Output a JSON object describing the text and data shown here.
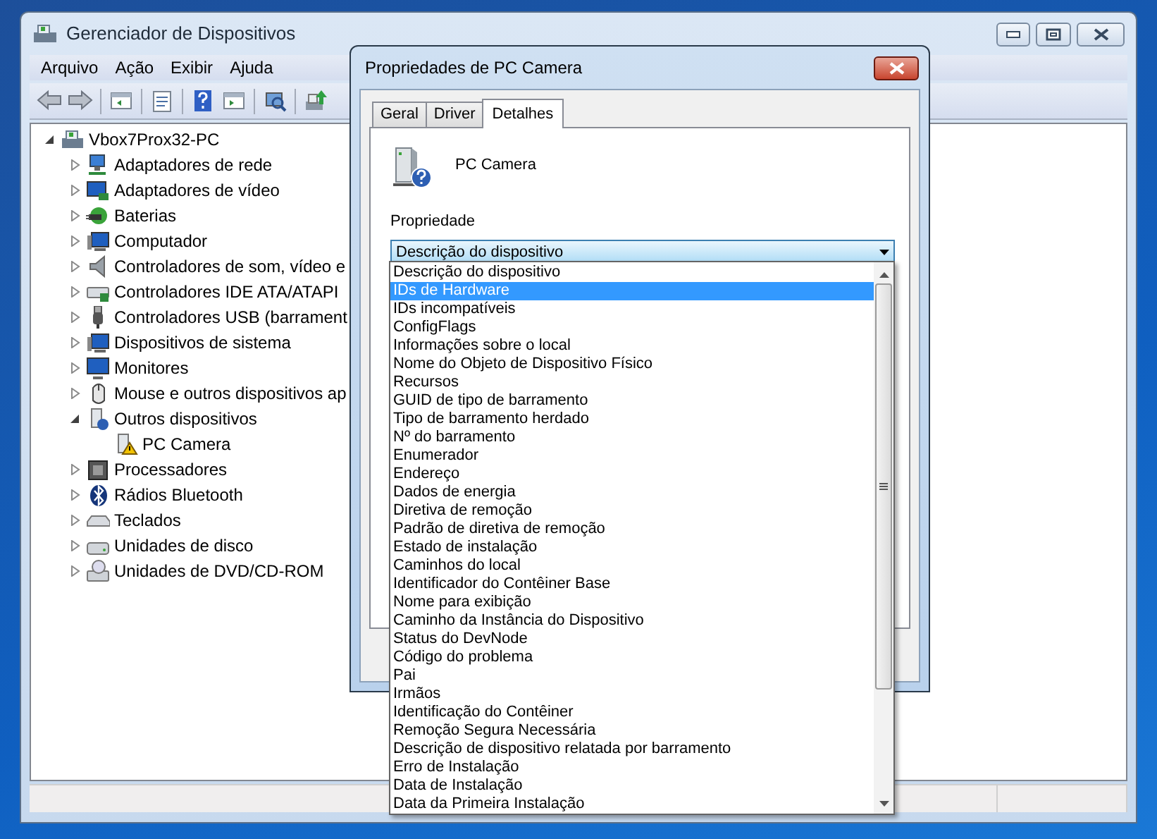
{
  "main_window": {
    "title": "Gerenciador de Dispositivos"
  },
  "menu": [
    "Arquivo",
    "Ação",
    "Exibir",
    "Ajuda"
  ],
  "tree": {
    "label": "Vbox7Prox32-PC",
    "expanded": true,
    "children": [
      {
        "label": "Adaptadores de rede",
        "expanded": false
      },
      {
        "label": "Adaptadores de vídeo",
        "expanded": false
      },
      {
        "label": "Baterias",
        "expanded": false
      },
      {
        "label": "Computador",
        "expanded": false
      },
      {
        "label": "Controladores de som, vídeo e",
        "expanded": false
      },
      {
        "label": "Controladores IDE ATA/ATAPI",
        "expanded": false
      },
      {
        "label": "Controladores USB (barrament",
        "expanded": false
      },
      {
        "label": "Dispositivos de sistema",
        "expanded": false
      },
      {
        "label": "Monitores",
        "expanded": false
      },
      {
        "label": "Mouse e outros dispositivos ap",
        "expanded": false
      },
      {
        "label": "Outros dispositivos",
        "expanded": true,
        "children": [
          {
            "label": "PC Camera",
            "warning": true
          }
        ]
      },
      {
        "label": "Processadores",
        "expanded": false
      },
      {
        "label": "Rádios Bluetooth",
        "expanded": false
      },
      {
        "label": "Teclados",
        "expanded": false
      },
      {
        "label": "Unidades de disco",
        "expanded": false
      },
      {
        "label": "Unidades de DVD/CD-ROM",
        "expanded": false
      }
    ]
  },
  "dialog": {
    "title": "Propriedades de PC Camera",
    "tabs": [
      {
        "label": "Geral",
        "selected": false
      },
      {
        "label": "Driver",
        "selected": false
      },
      {
        "label": "Detalhes",
        "selected": true
      }
    ],
    "device_name": "PC Camera",
    "property_label": "Propriedade",
    "property_value": "Descrição do dispositivo",
    "dropdown_options": [
      {
        "label": "Descrição do dispositivo",
        "selected": false
      },
      {
        "label": "IDs de Hardware",
        "selected": true
      },
      {
        "label": "IDs incompatíveis",
        "selected": false
      },
      {
        "label": "ConfigFlags",
        "selected": false
      },
      {
        "label": "Informações sobre o local",
        "selected": false
      },
      {
        "label": "Nome do Objeto de Dispositivo Físico",
        "selected": false
      },
      {
        "label": "Recursos",
        "selected": false
      },
      {
        "label": "GUID de tipo de barramento",
        "selected": false
      },
      {
        "label": "Tipo de barramento herdado",
        "selected": false
      },
      {
        "label": "Nº do barramento",
        "selected": false
      },
      {
        "label": "Enumerador",
        "selected": false
      },
      {
        "label": "Endereço",
        "selected": false
      },
      {
        "label": "Dados de energia",
        "selected": false
      },
      {
        "label": "Diretiva de remoção",
        "selected": false
      },
      {
        "label": "Padrão de diretiva de remoção",
        "selected": false
      },
      {
        "label": "Estado de instalação",
        "selected": false
      },
      {
        "label": "Caminhos do local",
        "selected": false
      },
      {
        "label": "Identificador do Contêiner Base",
        "selected": false
      },
      {
        "label": "Nome para exibição",
        "selected": false
      },
      {
        "label": "Caminho da Instância do Dispositivo",
        "selected": false
      },
      {
        "label": "Status do DevNode",
        "selected": false
      },
      {
        "label": "Código do problema",
        "selected": false
      },
      {
        "label": "Pai",
        "selected": false
      },
      {
        "label": "Irmãos",
        "selected": false
      },
      {
        "label": "Identificação do Contêiner",
        "selected": false
      },
      {
        "label": "Remoção Segura Necessária",
        "selected": false
      },
      {
        "label": "Descrição de dispositivo relatada por barramento",
        "selected": false
      },
      {
        "label": "Erro de Instalação",
        "selected": false
      },
      {
        "label": "Data de Instalação",
        "selected": false
      },
      {
        "label": "Data da Primeira Instalação",
        "selected": false
      }
    ]
  }
}
